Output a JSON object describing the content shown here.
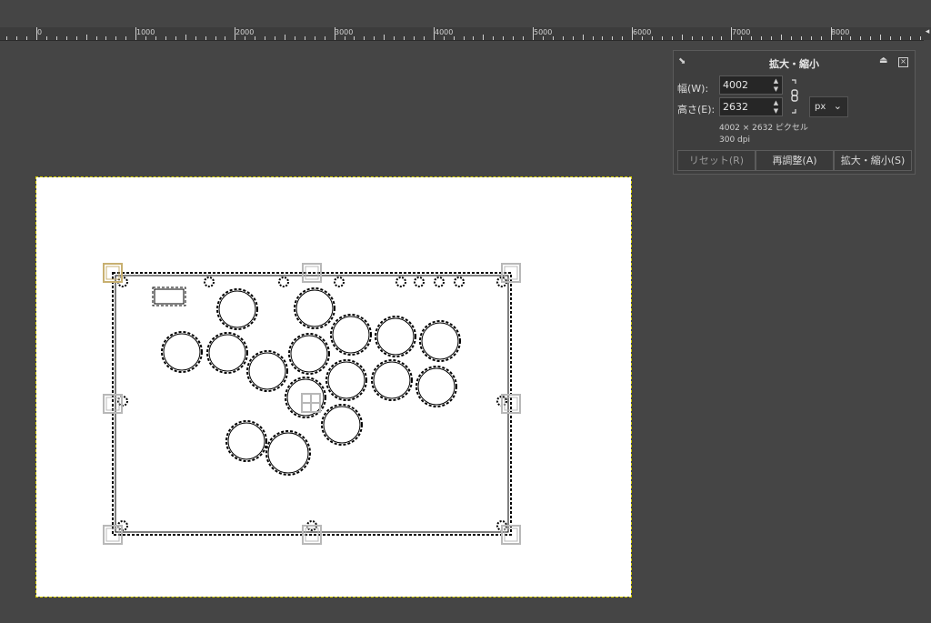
{
  "ruler": {
    "labels": [
      "0",
      "1000",
      "2000",
      "3000",
      "4000",
      "5000",
      "6000",
      "7000",
      "8000"
    ],
    "corner_icon": "navigate-icon"
  },
  "dialog": {
    "title": "拡大・縮小",
    "width_label": "幅(W):",
    "width_value": "4002",
    "height_label": "高さ(E):",
    "height_value": "2632",
    "unit": "px",
    "size_info": "4002 × 2632 ピクセル",
    "resolution_info": "300 dpi",
    "buttons": {
      "reset": "リセット(R)",
      "readjust": "再調整(A)",
      "scale": "拡大・縮小(S)"
    }
  },
  "colors": {
    "canvas_bg": "#454545",
    "image_bg": "#ffffff",
    "selection_border": "#d8d000",
    "handle": "#b8b8b8",
    "active_handle": "#c8b070"
  }
}
